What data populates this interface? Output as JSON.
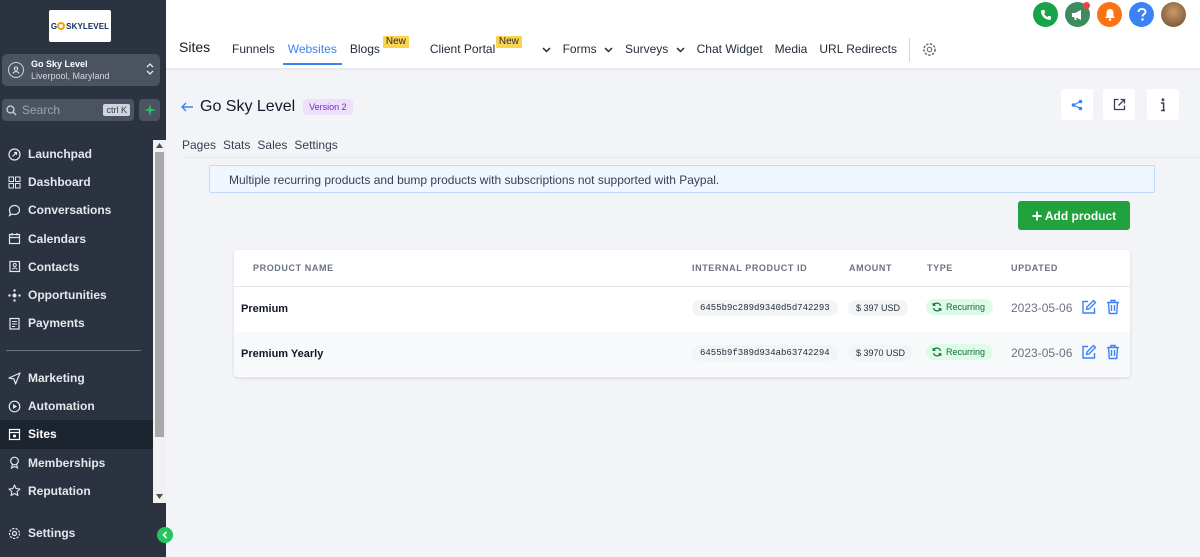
{
  "sidebar": {
    "logo_text": "G SKYLEVEL",
    "account_name": "Go Sky Level",
    "account_location": "Liverpool, Maryland",
    "search_placeholder": "Search",
    "search_shortcut": "ctrl K",
    "items_top": [
      {
        "label": "Launchpad",
        "icon": "rocket-icon"
      },
      {
        "label": "Dashboard",
        "icon": "grid-icon"
      },
      {
        "label": "Conversations",
        "icon": "chat-icon"
      },
      {
        "label": "Calendars",
        "icon": "calendar-icon"
      },
      {
        "label": "Contacts",
        "icon": "contacts-icon"
      },
      {
        "label": "Opportunities",
        "icon": "opportunities-icon"
      },
      {
        "label": "Payments",
        "icon": "payments-icon"
      }
    ],
    "items_bottom": [
      {
        "label": "Marketing",
        "icon": "send-icon"
      },
      {
        "label": "Automation",
        "icon": "automation-icon"
      },
      {
        "label": "Sites",
        "icon": "sites-icon",
        "active": true
      },
      {
        "label": "Memberships",
        "icon": "badge-icon"
      },
      {
        "label": "Reputation",
        "icon": "star-icon"
      }
    ],
    "settings_label": "Settings"
  },
  "topbar": {
    "title": "Sites",
    "tabs": [
      {
        "label": "Funnels"
      },
      {
        "label": "Websites",
        "active": true
      },
      {
        "label": "Blogs",
        "badge": "New"
      },
      {
        "label": "Client Portal",
        "badge": "New",
        "dropdown": true
      },
      {
        "label": "Forms",
        "dropdown": true
      },
      {
        "label": "Surveys",
        "dropdown": true
      },
      {
        "label": "Chat Widget"
      },
      {
        "label": "Media"
      },
      {
        "label": "URL Redirects"
      }
    ],
    "icon_colors": {
      "phone": "#16a34a",
      "megaphone": "#3d8b5f",
      "bell": "#f97316",
      "help": "#3b82f6"
    }
  },
  "page": {
    "title": "Go Sky Level",
    "version": "Version 2",
    "subtabs": [
      "Pages",
      "Stats",
      "Sales",
      "Settings"
    ],
    "alert": "Multiple recurring products and bump products with subscriptions not supported with Paypal.",
    "add_button": "Add product"
  },
  "table": {
    "headers": [
      "PRODUCT NAME",
      "INTERNAL PRODUCT ID",
      "AMOUNT",
      "TYPE",
      "UPDATED"
    ],
    "rows": [
      {
        "name": "Premium",
        "id": "6455b9c289d9340d5d742293",
        "amount": "$ 397 USD",
        "type": "Recurring",
        "updated": "2023-05-06"
      },
      {
        "name": "Premium Yearly",
        "id": "6455b9f389d934ab63742294",
        "amount": "$ 3970 USD",
        "type": "Recurring",
        "updated": "2023-05-06"
      }
    ]
  }
}
